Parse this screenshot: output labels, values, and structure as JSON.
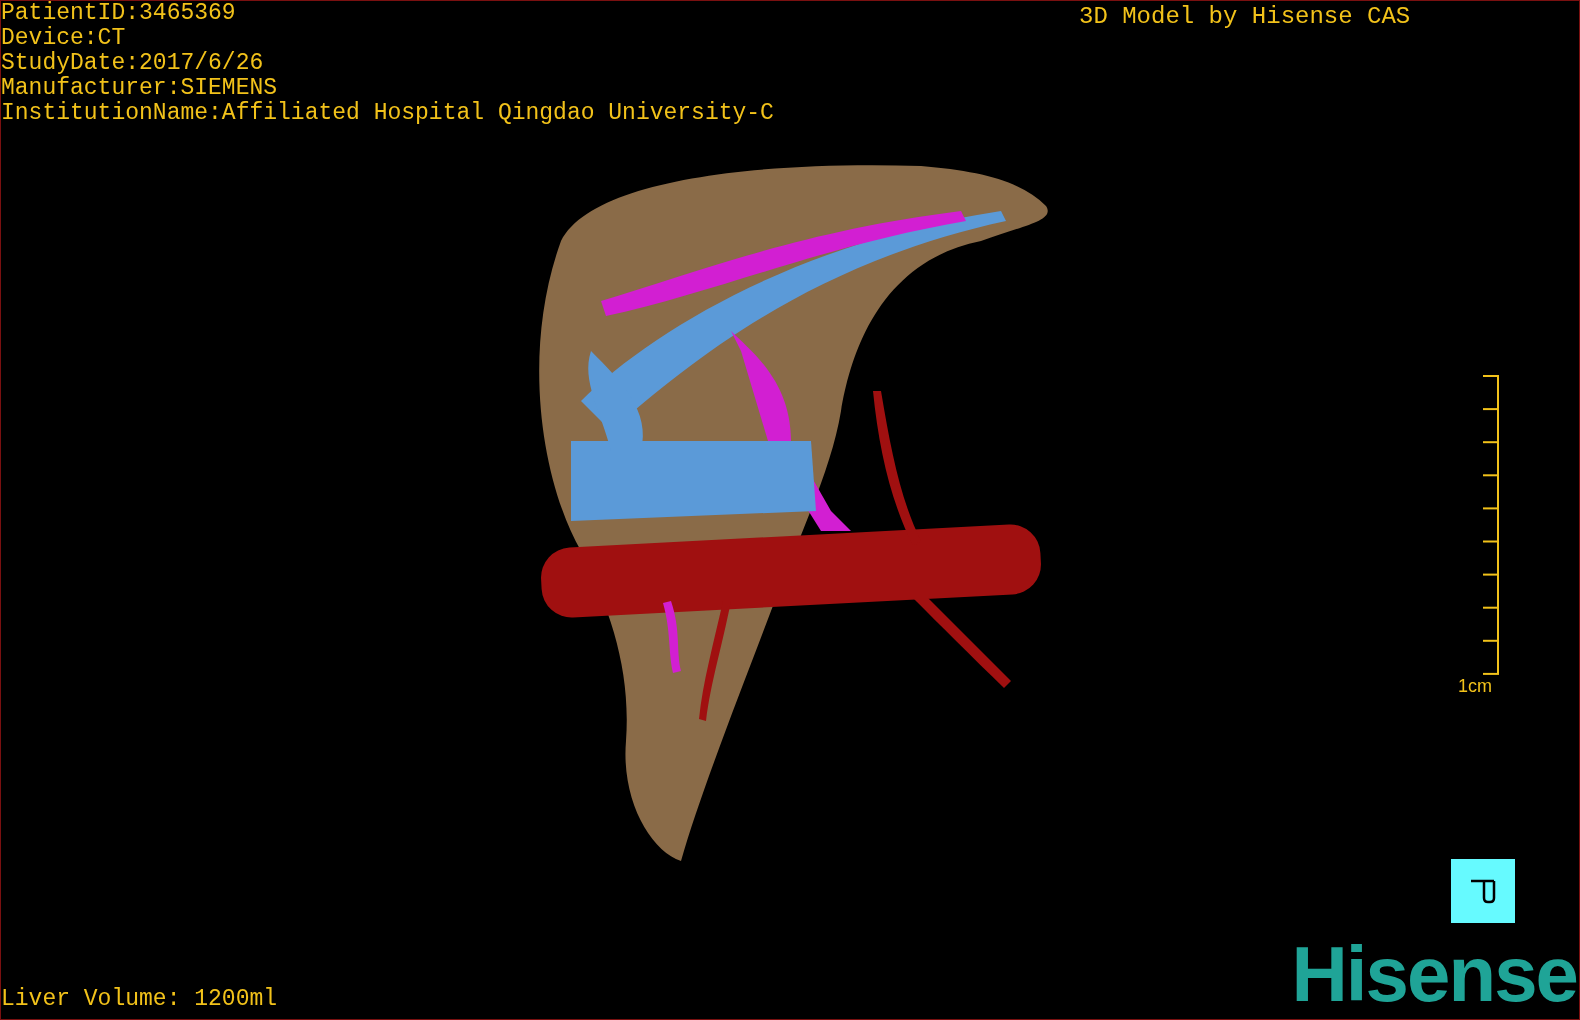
{
  "study_info": [
    "PatientID:3465369",
    "Device:CT",
    "StudyDate:2017/6/26",
    "Manufacturer:SIEMENS",
    "InstitutionName:Affiliated Hospital Qingdao University-C"
  ],
  "header": "3D Model by Hisense CAS",
  "scale_bar": {
    "label": "1cm"
  },
  "liver_volume": "Liver Volume: 1200ml",
  "logo": "Hisense",
  "viewport": {
    "kind": "room"
  }
}
